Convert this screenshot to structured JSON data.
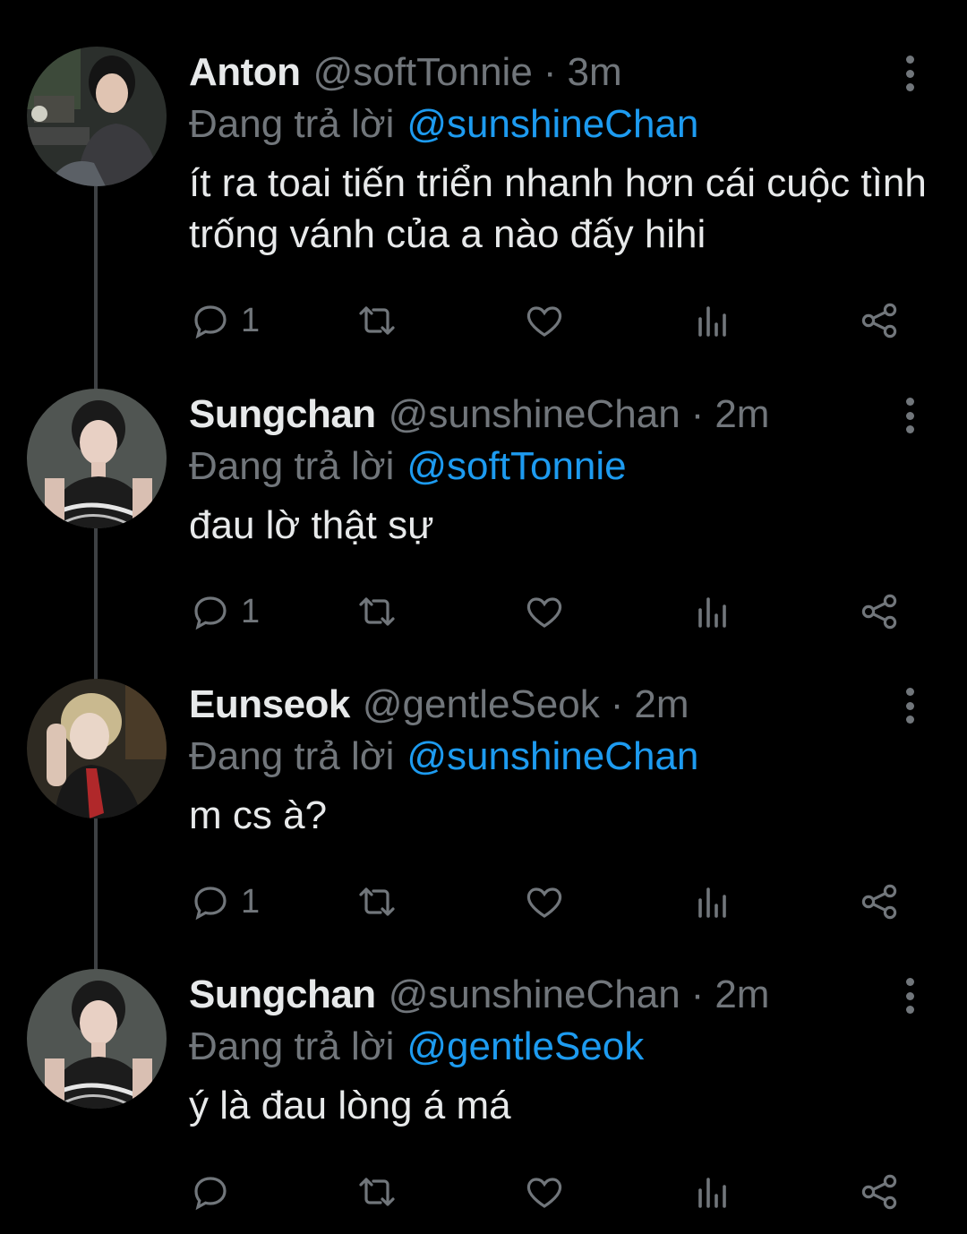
{
  "tweets": [
    {
      "name": "Anton",
      "handle": "@softTonnie",
      "separator": "·",
      "time": "3m",
      "reply_prefix": "Đang trả lời",
      "reply_to": "@sunshineChan",
      "text": "ít ra toai tiến triển nhanh hơn cái cuộc tình trống vánh của a nào đấy hihi",
      "reply_count": "1",
      "avatar": "avatar-photo-anton"
    },
    {
      "name": "Sungchan",
      "handle": "@sunshineChan",
      "separator": "·",
      "time": "2m",
      "reply_prefix": "Đang trả lời",
      "reply_to": "@softTonnie",
      "text": "đau lờ thật sự",
      "reply_count": "1",
      "avatar": "avatar-photo-sungchan"
    },
    {
      "name": "Eunseok",
      "handle": "@gentleSeok",
      "separator": "·",
      "time": "2m",
      "reply_prefix": "Đang trả lời",
      "reply_to": "@sunshineChan",
      "text": "m cs à?",
      "reply_count": "1",
      "avatar": "avatar-photo-eunseok"
    },
    {
      "name": "Sungchan",
      "handle": "@sunshineChan",
      "separator": "·",
      "time": "2m",
      "reply_prefix": "Đang trả lời",
      "reply_to": "@gentleSeok",
      "text": "ý là đau lòng á má",
      "reply_count": "",
      "avatar": "avatar-photo-sungchan"
    }
  ],
  "colors": {
    "background": "#000000",
    "text_primary": "#e7e9ea",
    "text_secondary": "#71767b",
    "accent": "#1d9bf0",
    "thread_line": "#3e4144"
  },
  "icons": [
    "reply-icon",
    "retweet-icon",
    "like-icon",
    "views-icon",
    "share-icon",
    "more-icon"
  ]
}
